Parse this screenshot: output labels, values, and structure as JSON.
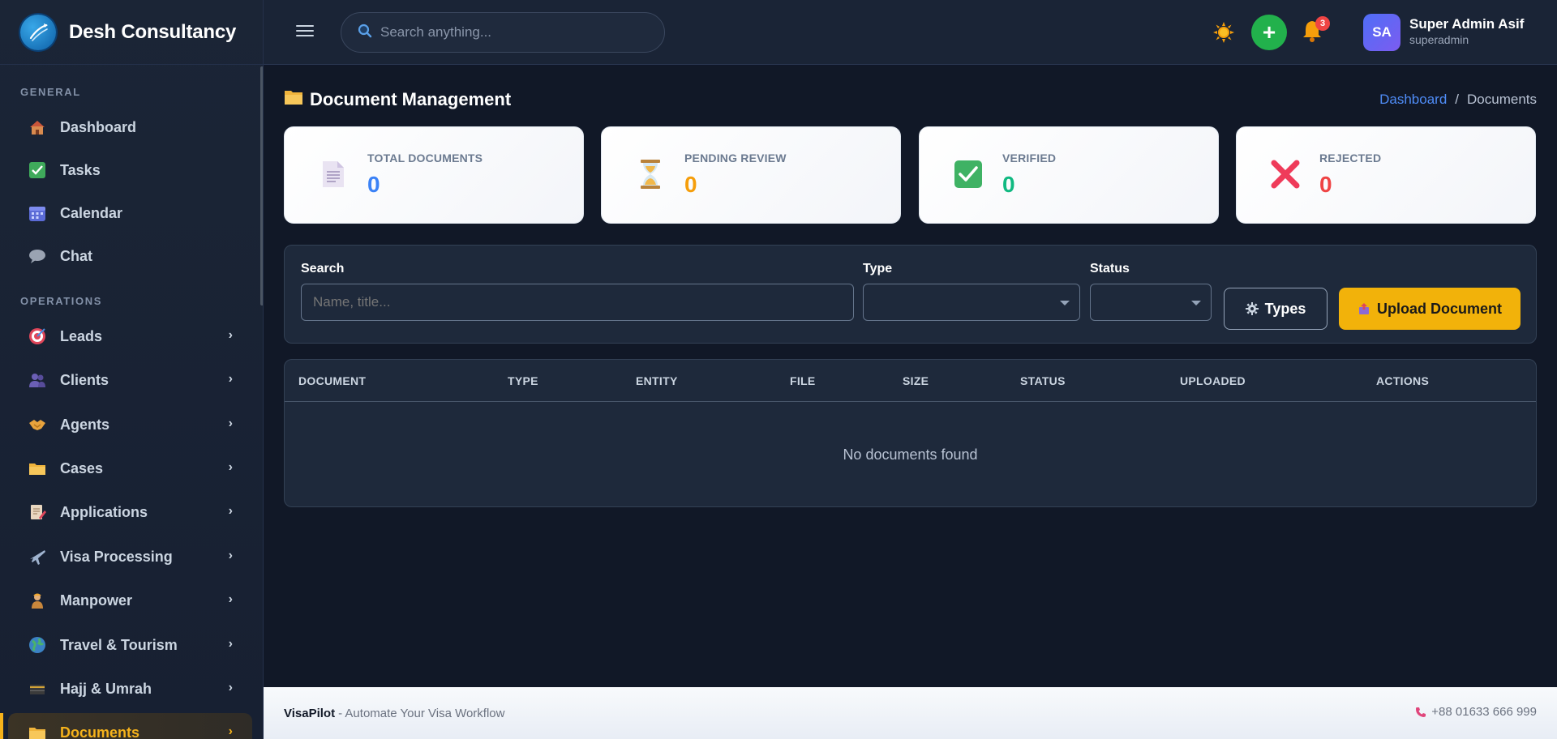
{
  "brand": {
    "name": "Desh Consultancy"
  },
  "sidebar": {
    "sections": [
      {
        "label": "GENERAL"
      },
      {
        "label": "OPERATIONS"
      }
    ],
    "items": [
      {
        "label": "Dashboard",
        "icon": "house-icon"
      },
      {
        "label": "Tasks",
        "icon": "checkbox-icon"
      },
      {
        "label": "Calendar",
        "icon": "calendar-icon"
      },
      {
        "label": "Chat",
        "icon": "speech-bubble-icon"
      },
      {
        "label": "Leads",
        "icon": "target-icon"
      },
      {
        "label": "Clients",
        "icon": "people-icon"
      },
      {
        "label": "Agents",
        "icon": "handshake-icon"
      },
      {
        "label": "Cases",
        "icon": "folder-icon"
      },
      {
        "label": "Applications",
        "icon": "form-icon"
      },
      {
        "label": "Visa Processing",
        "icon": "airplane-icon"
      },
      {
        "label": "Manpower",
        "icon": "worker-icon"
      },
      {
        "label": "Travel & Tourism",
        "icon": "globe-icon"
      },
      {
        "label": "Hajj & Umrah",
        "icon": "kaaba-icon"
      },
      {
        "label": "Documents",
        "icon": "folder-icon",
        "active": true
      }
    ]
  },
  "topbar": {
    "search_placeholder": "Search anything...",
    "notification_count": "3",
    "user": {
      "initials": "SA",
      "name": "Super Admin Asif",
      "role": "superadmin"
    }
  },
  "page": {
    "title": "Document Management",
    "breadcrumb": {
      "link": "Dashboard",
      "separator": "/",
      "current": "Documents"
    }
  },
  "stats": [
    {
      "label": "TOTAL DOCUMENTS",
      "value": "0",
      "color": "#3b82f6",
      "icon": "document-icon"
    },
    {
      "label": "PENDING REVIEW",
      "value": "0",
      "color": "#f59e0b",
      "icon": "hourglass-icon"
    },
    {
      "label": "VERIFIED",
      "value": "0",
      "color": "#10b981",
      "icon": "check-icon"
    },
    {
      "label": "REJECTED",
      "value": "0",
      "color": "#ef4444",
      "icon": "cross-icon"
    }
  ],
  "filters": {
    "search_label": "Search",
    "search_placeholder": "Name, title...",
    "type_label": "Type",
    "type_value": "",
    "status_label": "Status",
    "status_value": "",
    "types_button": "Types",
    "upload_button": "Upload Document"
  },
  "table": {
    "columns": [
      "DOCUMENT",
      "TYPE",
      "ENTITY",
      "FILE",
      "SIZE",
      "STATUS",
      "UPLOADED",
      "ACTIONS"
    ],
    "empty_message": "No documents found"
  },
  "footer": {
    "brand": "VisaPilot",
    "tagline": "- Automate Your Visa Workflow",
    "phone": "+88 01633 666 999"
  },
  "colors": {
    "accent": "#f2b20a",
    "link": "#4f8cf7",
    "success": "#22b14c"
  }
}
